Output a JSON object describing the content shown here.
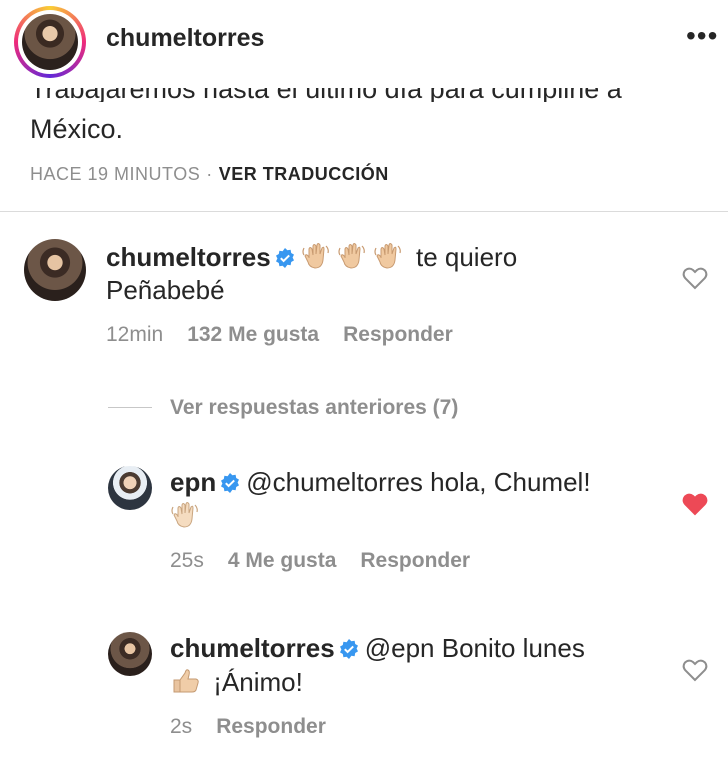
{
  "header": {
    "username": "chumeltorres",
    "more_icon": "ellipsis-icon"
  },
  "caption": {
    "cut_line": "Trabajaremos hasta el último día para cumplirle a",
    "text": "México.",
    "time": "HACE 19 MINUTOS",
    "separator": "·",
    "translate": "VER TRADUCCIÓN"
  },
  "comments": [
    {
      "user": "chumeltorres",
      "verified": true,
      "text_line1": "te quiero",
      "text_line2": "Peñabebé",
      "emoji": "waving-hand-icon",
      "emoji_count": 3,
      "time": "12min",
      "likes": "132 Me gusta",
      "reply": "Responder",
      "liked": false
    }
  ],
  "replies_toggle": "Ver respuestas anteriores (7)",
  "replies": [
    {
      "user": "epn",
      "verified": true,
      "text_line1": "@chumeltorres hola, Chumel!",
      "emoji": "waving-hand-icon",
      "time": "25s",
      "likes": "4 Me gusta",
      "reply": "Responder",
      "liked": true,
      "heart_color": "#ed4956"
    },
    {
      "user": "chumeltorres",
      "verified": true,
      "text_line1": "@epn Bonito lunes",
      "text_line2": "¡Ánimo!",
      "emoji": "thumbs-up-icon",
      "time": "2s",
      "reply": "Responder",
      "liked": false
    }
  ],
  "colors": {
    "verified": "#3897f0",
    "muted": "#8e8e8e",
    "text": "#262626",
    "like_red": "#ed4956"
  }
}
